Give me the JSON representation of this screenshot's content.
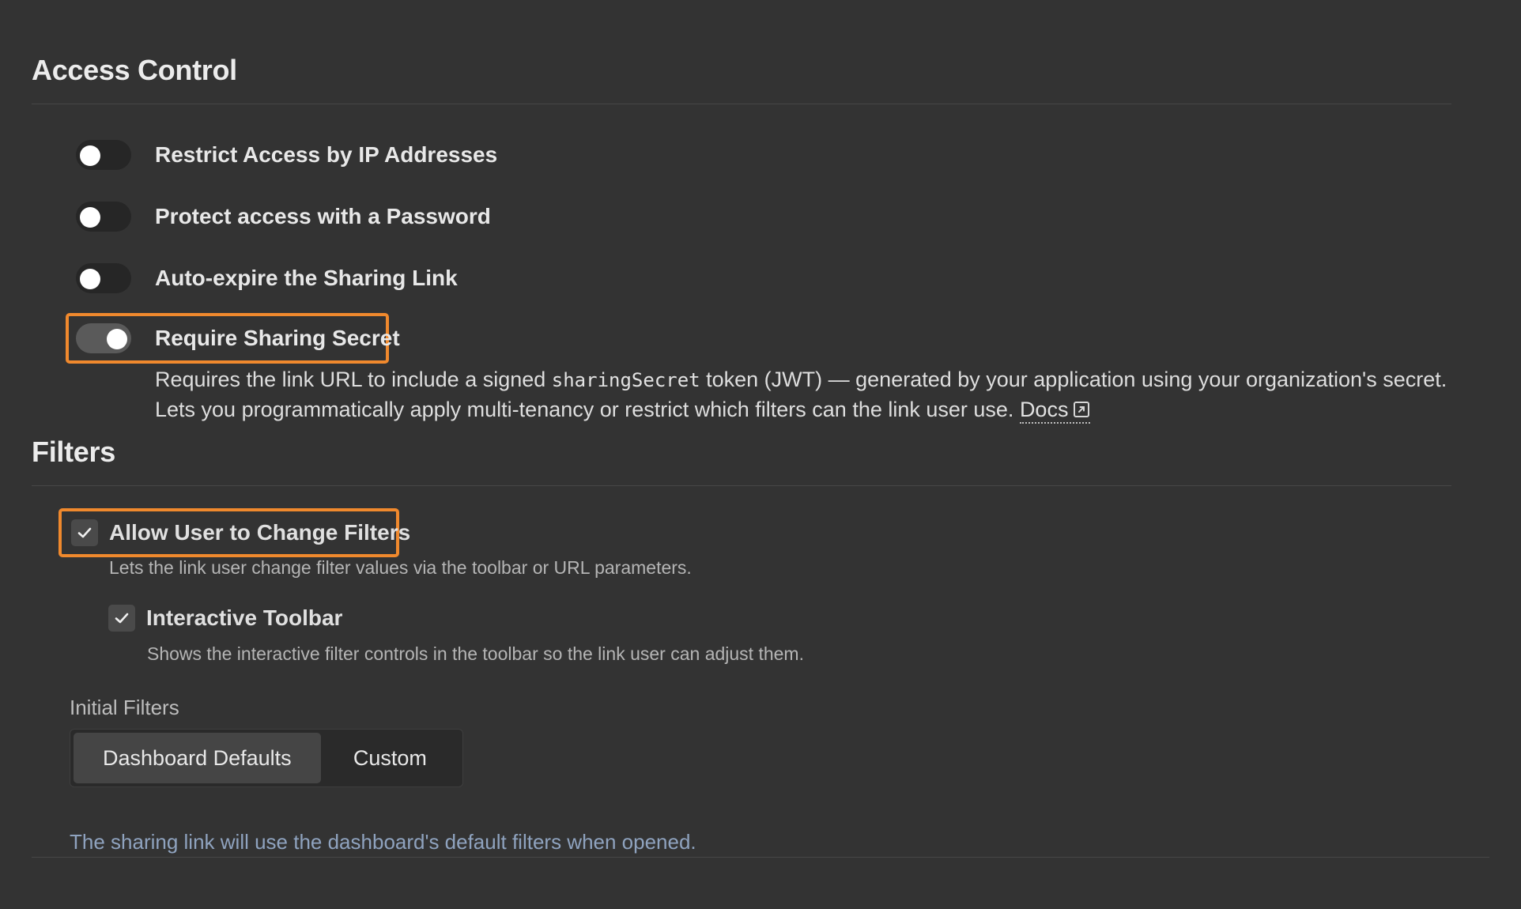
{
  "access_control": {
    "title": "Access Control",
    "toggles": [
      {
        "label": "Restrict Access by IP Addresses",
        "on": false
      },
      {
        "label": "Protect access with a Password",
        "on": false
      },
      {
        "label": "Auto-expire the Sharing Link",
        "on": false
      },
      {
        "label": "Require Sharing Secret",
        "on": true
      }
    ],
    "secret_desc": {
      "before": "Requires the link URL to include a signed ",
      "code": "sharingSecret",
      "after": " token (JWT) — generated by your application using your organization's secret. Lets you programmatically apply multi-tenancy or restrict which filters can the link user use. ",
      "docs_label": "Docs"
    }
  },
  "filters": {
    "title": "Filters",
    "allow_change": {
      "label": "Allow User to Change Filters",
      "checked": true,
      "desc": "Lets the link user change filter values via the toolbar or URL parameters."
    },
    "interactive_toolbar": {
      "label": "Interactive Toolbar",
      "checked": true,
      "desc": "Shows the interactive filter controls in the toolbar so the link user can adjust them."
    },
    "initial_filters": {
      "label": "Initial Filters",
      "options": [
        "Dashboard Defaults",
        "Custom"
      ],
      "selected": "Dashboard Defaults"
    },
    "info": "The sharing link will use the dashboard's default filters when opened."
  },
  "colors": {
    "background": "#333333",
    "highlight": "#f0892d",
    "info_text": "#8fa3bf"
  }
}
